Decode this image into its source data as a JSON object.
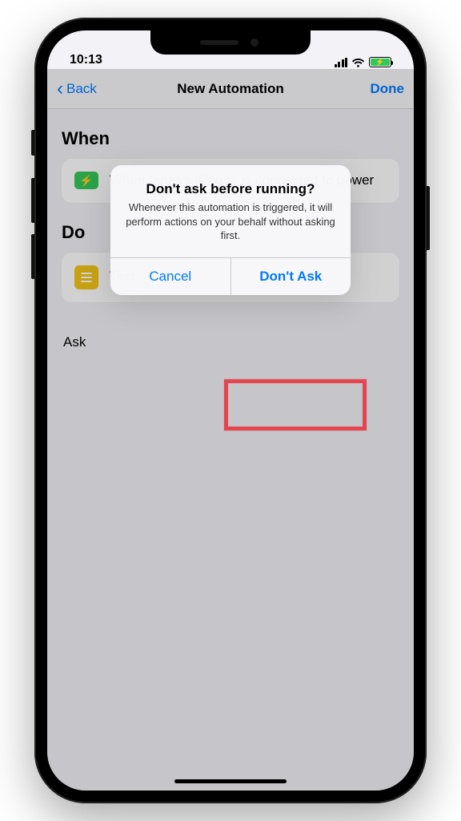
{
  "status": {
    "time": "10:13"
  },
  "nav": {
    "back": "Back",
    "title": "New Automation",
    "done": "Done"
  },
  "sections": {
    "when": {
      "heading": "When",
      "body": "When tahas's iPhone is connected to power"
    },
    "do": {
      "heading": "Do",
      "body": "Text"
    },
    "ask": {
      "label": "Ask"
    }
  },
  "alert": {
    "title": "Don't ask before running?",
    "message": "Whenever this automation is triggered, it will perform actions on your behalf without asking first.",
    "cancel": "Cancel",
    "confirm": "Don't Ask"
  }
}
